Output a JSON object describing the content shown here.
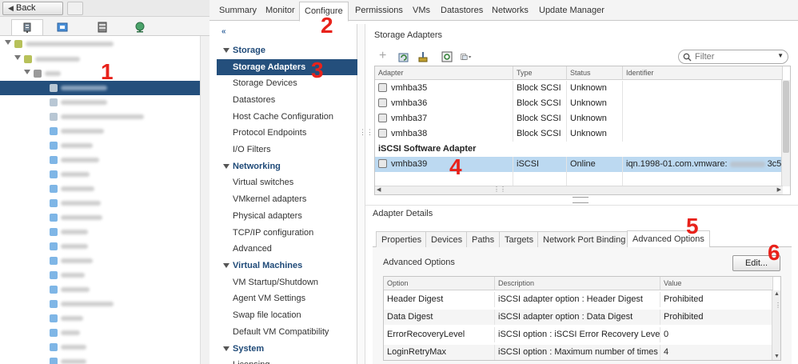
{
  "navigator": {
    "back_label": "Back",
    "tabs": [
      "hosts-clusters-icon",
      "vms-icon",
      "storage-icon",
      "networking-icon"
    ]
  },
  "top_tabs": [
    "Summary",
    "Monitor",
    "Configure",
    "Permissions",
    "VMs",
    "Datastores",
    "Networks",
    "Update Manager"
  ],
  "active_top_tab": "Configure",
  "config_menu": {
    "collapse_glyph": "«",
    "sections": [
      {
        "label": "Storage",
        "items": [
          "Storage Adapters",
          "Storage Devices",
          "Datastores",
          "Host Cache Configuration",
          "Protocol Endpoints",
          "I/O Filters"
        ]
      },
      {
        "label": "Networking",
        "items": [
          "Virtual switches",
          "VMkernel adapters",
          "Physical adapters",
          "TCP/IP configuration",
          "Advanced"
        ]
      },
      {
        "label": "Virtual Machines",
        "items": [
          "VM Startup/Shutdown",
          "Agent VM Settings",
          "Swap file location",
          "Default VM Compatibility"
        ]
      },
      {
        "label": "System",
        "items": [
          "Licensing"
        ]
      }
    ],
    "selected": "Storage Adapters"
  },
  "storage_adapters": {
    "title": "Storage Adapters",
    "filter_placeholder": "Filter",
    "columns": [
      "Adapter",
      "Type",
      "Status",
      "Identifier"
    ],
    "rows": [
      {
        "adapter": "vmhba35",
        "type": "Block SCSI",
        "status": "Unknown",
        "identifier": ""
      },
      {
        "adapter": "vmhba36",
        "type": "Block SCSI",
        "status": "Unknown",
        "identifier": ""
      },
      {
        "adapter": "vmhba37",
        "type": "Block SCSI",
        "status": "Unknown",
        "identifier": ""
      },
      {
        "adapter": "vmhba38",
        "type": "Block SCSI",
        "status": "Unknown",
        "identifier": ""
      }
    ],
    "group_label": "iSCSI Software Adapter",
    "selected_row": {
      "adapter": "vmhba39",
      "type": "iSCSI",
      "status": "Online",
      "identifier": "iqn.1998-01.com.vmware:",
      "identifier_suffix": "3c5"
    }
  },
  "adapter_details": {
    "title": "Adapter Details",
    "tabs": [
      "Properties",
      "Devices",
      "Paths",
      "Targets",
      "Network Port Binding",
      "Advanced Options"
    ],
    "active_tab": "Advanced Options",
    "section_title": "Advanced Options",
    "edit_label": "Edit...",
    "columns": [
      "Option",
      "Description",
      "Value"
    ],
    "rows": [
      {
        "option": "Header Digest",
        "description": "iSCSI adapter option : Header Digest",
        "value": "Prohibited"
      },
      {
        "option": "Data Digest",
        "description": "iSCSI adapter option : Data Digest",
        "value": "Prohibited"
      },
      {
        "option": "ErrorRecoveryLevel",
        "description": "iSCSI option : iSCSI Error Recovery Leve...",
        "value": "0"
      },
      {
        "option": "LoginRetryMax",
        "description": "iSCSI option : Maximum number of times ...",
        "value": "4"
      }
    ]
  },
  "annotations": [
    "1",
    "2",
    "3",
    "4",
    "5",
    "6"
  ],
  "colors": {
    "annotation": "#e8221b",
    "selection": "#244f7c",
    "row_highlight": "#bcd9f1"
  }
}
